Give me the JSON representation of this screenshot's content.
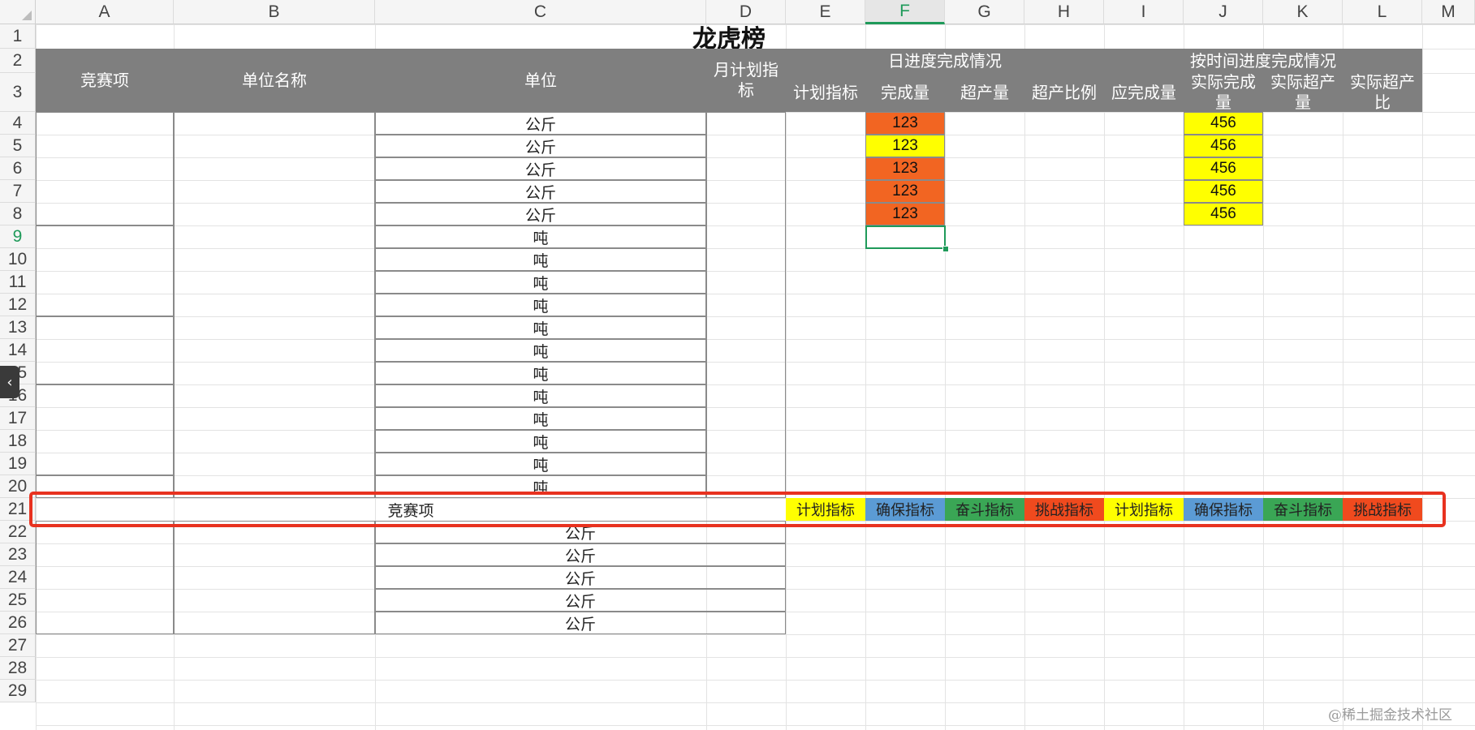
{
  "columns": [
    "A",
    "B",
    "C",
    "D",
    "E",
    "F",
    "G",
    "H",
    "I",
    "J",
    "K",
    "L",
    "M"
  ],
  "rows": [
    "1",
    "2",
    "3",
    "4",
    "5",
    "6",
    "7",
    "8",
    "9",
    "10",
    "11",
    "12",
    "13",
    "14",
    "15",
    "16",
    "17",
    "18",
    "19",
    "20",
    "21",
    "22",
    "23",
    "24",
    "25",
    "26",
    "27",
    "28",
    "29"
  ],
  "selected": {
    "column": "F",
    "row": "9"
  },
  "title": "龙虎榜",
  "headers": {
    "contest_item": "竞赛项",
    "unit_name": "单位名称",
    "unit": "单位",
    "monthly_plan": "月计划指标",
    "daily_progress": "日进度完成情况",
    "plan_target": "计划指标",
    "completed": "完成量",
    "over_amount": "超产量",
    "over_ratio": "超产比例",
    "should_complete": "应完成量",
    "time_progress": "按时间进度完成情况",
    "actual_completed": "实际完成量",
    "actual_over_amount": "实际超产量",
    "actual_over_ratio": "实际超产比"
  },
  "units_upper": [
    "公斤",
    "公斤",
    "公斤",
    "公斤",
    "公斤",
    "吨",
    "吨",
    "吨",
    "吨",
    "吨",
    "吨",
    "吨",
    "吨",
    "吨",
    "吨",
    "吨",
    "吨"
  ],
  "f_values": [
    "123",
    "123",
    "123",
    "123",
    "123"
  ],
  "j_values": [
    "456",
    "456",
    "456",
    "456",
    "456"
  ],
  "legend_row": {
    "label": "竞赛项",
    "items": [
      "计划指标",
      "确保指标",
      "奋斗指标",
      "挑战指标",
      "计划指标",
      "确保指标",
      "奋斗指标",
      "挑战指标"
    ]
  },
  "units_lower": [
    "公斤",
    "公斤",
    "公斤",
    "公斤",
    "公斤"
  ],
  "watermark": "@稀土掘金技术社区",
  "side_tab_glyph": "‹",
  "colors": {
    "header_gray": "#7f7f7f",
    "orange": "#f26522",
    "yellow": "#ffff00",
    "blue": "#5b9bd5",
    "green": "#3aa655",
    "red": "#f04a1e",
    "selection_green": "#1f9a5a",
    "highlight_red": "#e8321f"
  }
}
